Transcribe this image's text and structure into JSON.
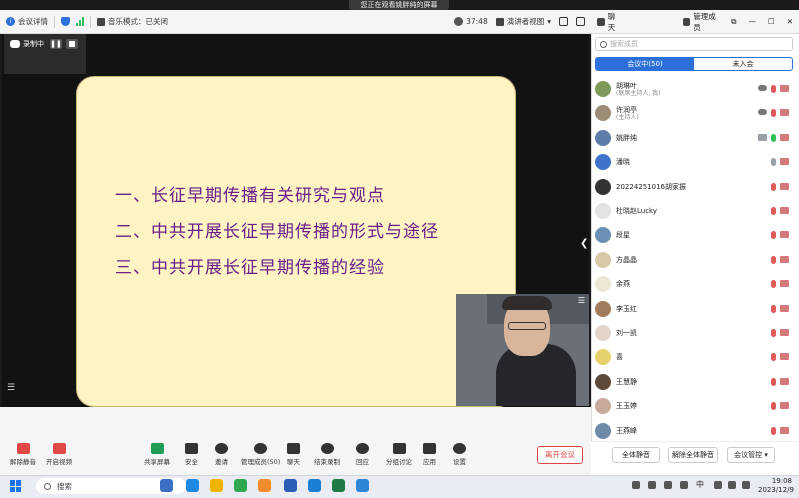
{
  "banner": {
    "text": "您正在观看姚胖纯的屏幕"
  },
  "titlebar": {
    "meeting_details": "会议详情",
    "music_mode": "音乐模式：已关闭",
    "time": "37:48",
    "view_mode": "演讲者视图",
    "meeting_details_icon": "info-icon",
    "security_icon": "shield-icon",
    "signal_icon": "signal-bars-icon",
    "colors": {
      "signal": "#2fbf56",
      "accent": "#2d6fd9"
    }
  },
  "recording": {
    "label": "录制中"
  },
  "slide": {
    "lines": [
      "一、长征早期传播有关研究与观点",
      "二、中共开展长征早期传播的形式与途径",
      "三、中共开展长征早期传播的经验"
    ],
    "background": "#fdf3c3",
    "text_color": "#6b1e8a"
  },
  "toolbar": {
    "items": [
      {
        "label": "解除静音",
        "icon": "mic-muted-icon"
      },
      {
        "label": "开启视频",
        "icon": "camera-off-icon"
      },
      {
        "label": "共享屏幕",
        "icon": "share-screen-icon"
      },
      {
        "label": "安全",
        "icon": "shield-icon"
      },
      {
        "label": "邀请",
        "icon": "invite-icon"
      },
      {
        "label": "管理成员(50)",
        "icon": "members-icon"
      },
      {
        "label": "聊天",
        "icon": "chat-icon"
      },
      {
        "label": "结束录制",
        "icon": "stop-record-icon"
      },
      {
        "label": "回应",
        "icon": "reaction-icon"
      },
      {
        "label": "分组讨论",
        "icon": "breakout-icon"
      },
      {
        "label": "应用",
        "icon": "apps-icon"
      },
      {
        "label": "设置",
        "icon": "settings-icon"
      }
    ],
    "leave_label": "离开会议",
    "leave_color": "#e04848"
  },
  "panel": {
    "chat_label": "聊天",
    "members_label": "管理成员",
    "search_placeholder": "搜索成员",
    "tab_in_meeting": "会议中(50)",
    "tab_not_joined": "未入会",
    "participants": [
      {
        "name": "胡琳叶",
        "sub": "(联席主持人, 我)",
        "avatar_color": "#7d9a5b",
        "mic": "muted",
        "cam": "off",
        "cloud": true
      },
      {
        "name": "许润亭",
        "sub": "(主持人)",
        "avatar_color": "#9c8d77",
        "mic": "muted",
        "cam": "off",
        "cloud": true
      },
      {
        "name": "姚胖纯",
        "sub": "",
        "avatar_color": "#5b7da8",
        "mic": "on",
        "cam": "off",
        "screen": true
      },
      {
        "name": "潘晓",
        "sub": "",
        "avatar_color": "#3f73c9",
        "mic": "muted-gray",
        "cam": "off"
      },
      {
        "name": "2022425101​6胡家振",
        "sub": "",
        "avatar_color": "#333333",
        "mic": "muted",
        "cam": "off"
      },
      {
        "name": "杜晓赵Lucky",
        "sub": "",
        "avatar_color": "#e3e3e3",
        "mic": "muted",
        "cam": "off"
      },
      {
        "name": "段星",
        "sub": "",
        "avatar_color": "#6c8fb6",
        "mic": "muted",
        "cam": "off"
      },
      {
        "name": "方晶晶",
        "sub": "",
        "avatar_color": "#d9c8a7",
        "mic": "muted",
        "cam": "off"
      },
      {
        "name": "余燕",
        "sub": "",
        "avatar_color": "#ece7d3",
        "mic": "muted",
        "cam": "off"
      },
      {
        "name": "李玉红",
        "sub": "",
        "avatar_color": "#a07b5c",
        "mic": "muted",
        "cam": "off"
      },
      {
        "name": "刘一凯",
        "sub": "",
        "avatar_color": "#e3d6c9",
        "mic": "muted",
        "cam": "off"
      },
      {
        "name": "喜",
        "sub": "",
        "avatar_color": "#e6d26c",
        "mic": "muted",
        "cam": "off"
      },
      {
        "name": "王慧静",
        "sub": "",
        "avatar_color": "#5d4a3b",
        "mic": "muted",
        "cam": "off"
      },
      {
        "name": "王玉婷",
        "sub": "",
        "avatar_color": "#c9a99a",
        "mic": "muted",
        "cam": "off"
      },
      {
        "name": "王燕峰",
        "sub": "",
        "avatar_color": "#6f8aa8",
        "mic": "muted",
        "cam": "off"
      }
    ],
    "mute_all": "全体静音",
    "unmute_all": "解除全体静音",
    "meeting_control": "会议管控"
  },
  "taskbar": {
    "search_label": "搜索",
    "time": "19:08",
    "date": "2023/12/9",
    "lang": "中"
  }
}
